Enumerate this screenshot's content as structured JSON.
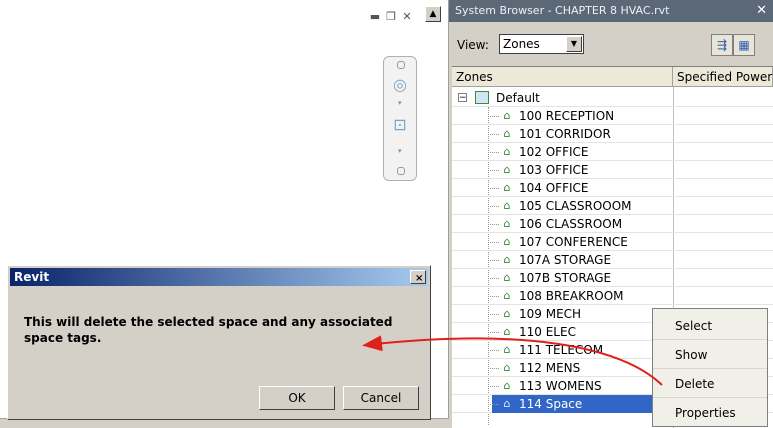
{
  "view_area": {
    "window_buttons": [
      "minimize-icon",
      "restore-icon",
      "close-icon"
    ]
  },
  "dialog": {
    "title": "Revit",
    "close_glyph": "×",
    "message": "This will delete the selected space and any associated space tags.",
    "ok_label": "OK",
    "cancel_label": "Cancel"
  },
  "system_browser": {
    "title": "System Browser - CHAPTER 8 HVAC.rvt",
    "view_label": "View:",
    "view_value": "Zones",
    "columns": [
      "Zones",
      "Specified Power"
    ],
    "root": "Default",
    "spaces": [
      "100 RECEPTION",
      "101 CORRIDOR",
      "102 OFFICE",
      "103 OFFICE",
      "104 OFFICE",
      "105 CLASSROOOM",
      "106 CLASSROOM",
      "107 CONFERENCE",
      "107A STORAGE",
      "107B STORAGE",
      "108 BREAKROOM",
      "109 MECH",
      "110 ELEC",
      "111 TELECOM",
      "112 MENS",
      "113 WOMENS",
      "114 Space"
    ],
    "selected_space": "114 Space"
  },
  "context_menu": {
    "items": [
      "Select",
      "Show",
      "Delete",
      "Properties"
    ]
  },
  "colors": {
    "titlebar_dark": "#0a246a",
    "selection": "#3166c6",
    "arrow": "#e0201b"
  }
}
